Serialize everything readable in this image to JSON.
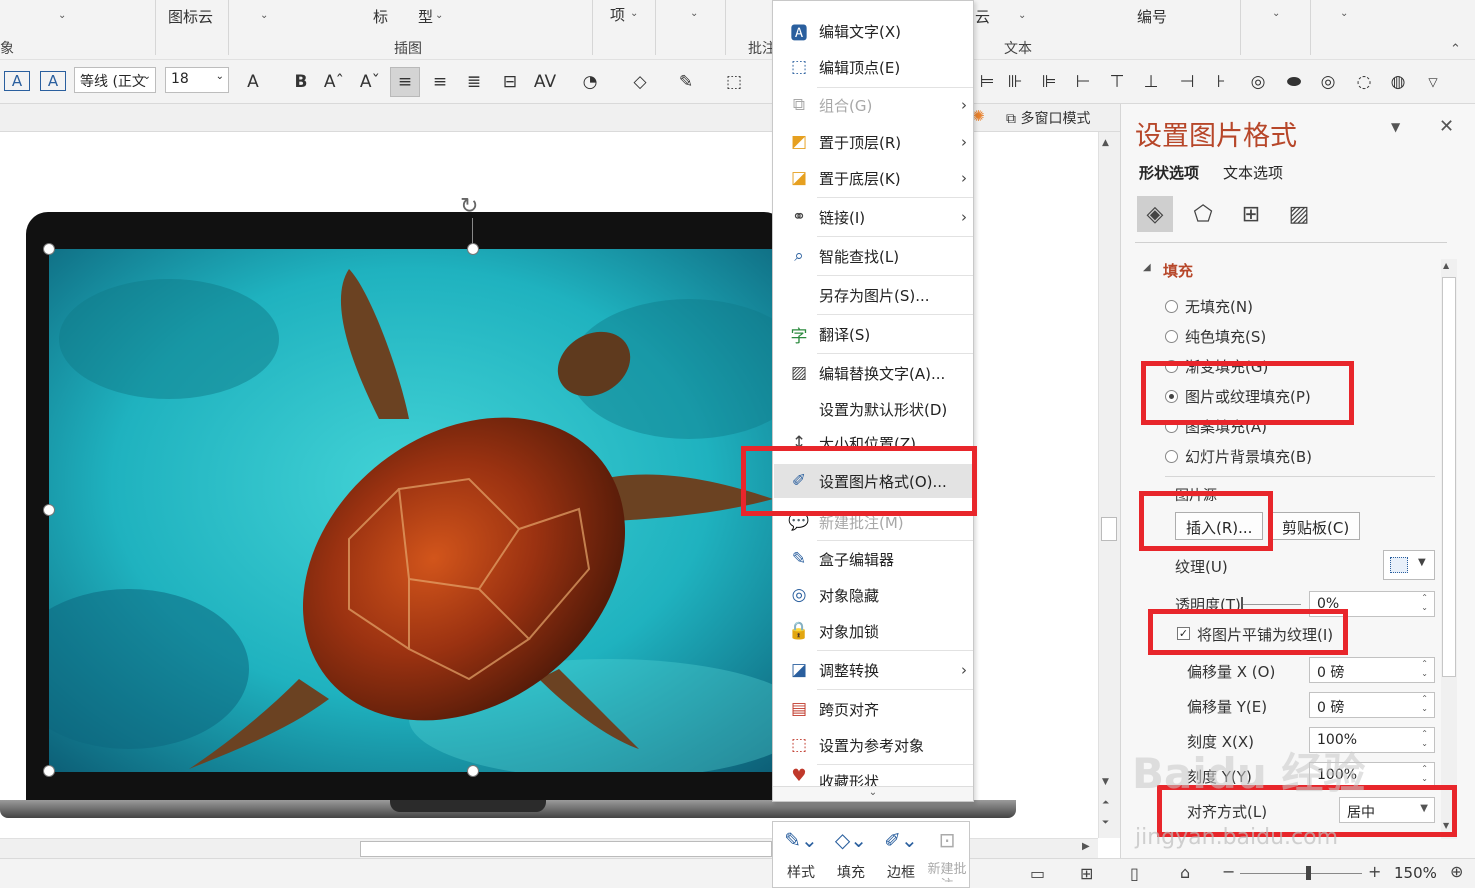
{
  "ribbon": {
    "top_fragments": [
      "图标云",
      "标",
      "型",
      "项",
      "云",
      "编号"
    ],
    "groups": [
      "插图",
      "批注",
      "文本"
    ],
    "left_group": "象",
    "font_name": "等线 (正文",
    "font_size": "18",
    "format_buttons": [
      "A",
      "B"
    ]
  },
  "view_bar": {
    "multi_window": "多窗口模式"
  },
  "context_menu": {
    "items": [
      {
        "label": "编辑文字(X)",
        "icon": "edit-text-icon"
      },
      {
        "label": "编辑顶点(E)",
        "icon": "edit-points-icon"
      },
      {
        "label": "组合(G)",
        "icon": "group-icon"
      },
      {
        "label": "置于顶层(R)",
        "icon": "bring-front-icon"
      },
      {
        "label": "置于底层(K)",
        "icon": "send-back-icon"
      },
      {
        "label": "链接(I)",
        "icon": "link-icon"
      },
      {
        "label": "智能查找(L)",
        "icon": "smart-lookup-icon"
      },
      {
        "label": "另存为图片(S)...",
        "icon": ""
      },
      {
        "label": "翻译(S)",
        "icon": "translate-icon"
      },
      {
        "label": "编辑替换文字(A)...",
        "icon": "alt-text-icon"
      },
      {
        "label": "设置为默认形状(D)",
        "icon": ""
      },
      {
        "label": "大小和位置(Z)...",
        "icon": "size-position-icon"
      },
      {
        "label": "设置图片格式(O)...",
        "icon": "format-picture-icon"
      },
      {
        "label": "新建批注(M)",
        "icon": "new-comment-icon"
      },
      {
        "label": "盒子编辑器",
        "icon": "box-editor-icon"
      },
      {
        "label": "对象隐藏",
        "icon": "hide-object-icon"
      },
      {
        "label": "对象加锁",
        "icon": "lock-icon"
      },
      {
        "label": "调整转换",
        "icon": "convert-icon"
      },
      {
        "label": "跨页对齐",
        "icon": "align-pages-icon"
      },
      {
        "label": "设置为参考对象",
        "icon": "reference-icon"
      },
      {
        "label": "收藏形状",
        "icon": "favorite-icon"
      }
    ]
  },
  "mini_toolbar": {
    "style": "样式",
    "fill": "填充",
    "border": "边框",
    "new_comment": "新建批注"
  },
  "pane": {
    "title": "设置图片格式",
    "tabs": [
      "形状选项",
      "文本选项"
    ],
    "section": "填充",
    "fill_options": [
      {
        "label": "无填充(N)",
        "checked": false
      },
      {
        "label": "纯色填充(S)",
        "checked": false
      },
      {
        "label": "渐变填充(G)",
        "checked": false
      },
      {
        "label": "图片或纹理填充(P)",
        "checked": true
      },
      {
        "label": "图案填充(A)",
        "checked": false
      },
      {
        "label": "幻灯片背景填充(B)",
        "checked": false
      }
    ],
    "picture_source": "图片源",
    "insert_button": "插入(R)...",
    "clipboard_button": "剪贴板(C)",
    "texture_label": "纹理(U)",
    "transparency_label": "透明度(T)",
    "transparency_value": "0%",
    "tile_label": "将图片平铺为纹理(I)",
    "tile_checked": true,
    "offset_x_label": "偏移量 X (O)",
    "offset_x_value": "0 磅",
    "offset_y_label": "偏移量 Y(E)",
    "offset_y_value": "0 磅",
    "scale_x_label": "刻度 X(X)",
    "scale_x_value": "100%",
    "scale_y_label": "刻度 Y(Y)",
    "scale_y_value": "100%",
    "align_label": "对齐方式(L)",
    "align_value": "居中"
  },
  "status": {
    "zoom": "150%"
  },
  "watermark": {
    "main": "Baidu 经验",
    "url": "jingyan.baidu.com"
  }
}
